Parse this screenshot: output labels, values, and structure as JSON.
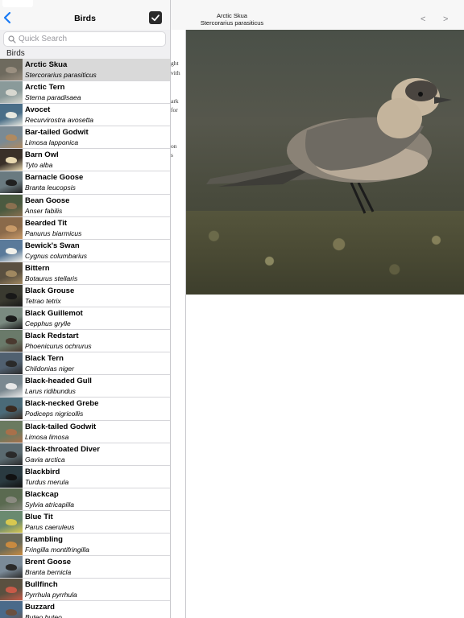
{
  "master": {
    "title": "Birds",
    "back_icon": "chevron-left-icon",
    "done_icon": "checkmark-icon",
    "search": {
      "placeholder": "Quick Search",
      "value": ""
    },
    "section_header": "Birds",
    "items": [
      {
        "name": "Arctic Skua",
        "latin": "Stercorarius parasiticus",
        "selected": true,
        "colors": [
          "#6e6a5e",
          "#9a8f80"
        ]
      },
      {
        "name": "Arctic Tern",
        "latin": "Sterna paradisaea",
        "colors": [
          "#8a9a9a",
          "#d8d8d0"
        ]
      },
      {
        "name": "Avocet",
        "latin": "Recurvirostra avosetta",
        "colors": [
          "#4a6e88",
          "#e8e8e0"
        ]
      },
      {
        "name": "Bar-tailed Godwit",
        "latin": "Limosa lapponica",
        "colors": [
          "#7a8a94",
          "#b08a60"
        ]
      },
      {
        "name": "Barn Owl",
        "latin": "Tyto alba",
        "colors": [
          "#3a3028",
          "#e8d8b0"
        ]
      },
      {
        "name": "Barnacle Goose",
        "latin": "Branta leucopsis",
        "colors": [
          "#6a7a80",
          "#202020"
        ]
      },
      {
        "name": "Bean Goose",
        "latin": "Anser fabilis",
        "colors": [
          "#4a5a40",
          "#8a7050"
        ]
      },
      {
        "name": "Bearded Tit",
        "latin": "Panurus biarmicus",
        "colors": [
          "#8a6a4a",
          "#c89a68"
        ]
      },
      {
        "name": "Bewick's Swan",
        "latin": "Cygnus columbarius",
        "colors": [
          "#5a7a9a",
          "#f0f0ea"
        ]
      },
      {
        "name": "Bittern",
        "latin": "Botaurus stellaris",
        "colors": [
          "#5a5040",
          "#a08860"
        ]
      },
      {
        "name": "Black Grouse",
        "latin": "Tetrao tetrix",
        "colors": [
          "#3a3a30",
          "#181818"
        ]
      },
      {
        "name": "Black Guillemot",
        "latin": "Cepphus grylle",
        "colors": [
          "#7a8a80",
          "#1a1a1a"
        ]
      },
      {
        "name": "Black Redstart",
        "latin": "Phoenicurus ochrurus",
        "colors": [
          "#6a7a6a",
          "#4a3a30"
        ]
      },
      {
        "name": "Black Tern",
        "latin": "Chlidonias niger",
        "colors": [
          "#506070",
          "#2a2a2a"
        ]
      },
      {
        "name": "Black-headed Gull",
        "latin": "Larus ridibundus",
        "colors": [
          "#7a8890",
          "#e8e8e8"
        ]
      },
      {
        "name": "Black-necked Grebe",
        "latin": "Podiceps nigricollis",
        "colors": [
          "#4a6a78",
          "#3a2a20"
        ]
      },
      {
        "name": "Black-tailed Godwit",
        "latin": "Limosa limosa",
        "colors": [
          "#6a7a60",
          "#a8704a"
        ]
      },
      {
        "name": "Black-throated Diver",
        "latin": "Gavia arctica",
        "colors": [
          "#5a6a70",
          "#2a2a2a"
        ]
      },
      {
        "name": "Blackbird",
        "latin": "Turdus merula",
        "colors": [
          "#2a3a40",
          "#111111"
        ]
      },
      {
        "name": "Blackcap",
        "latin": "Sylvia atricapilla",
        "colors": [
          "#5a6a50",
          "#8a8a80"
        ]
      },
      {
        "name": "Blue Tit",
        "latin": "Parus caeruleus",
        "colors": [
          "#6a8a70",
          "#d8c850"
        ]
      },
      {
        "name": "Brambling",
        "latin": "Fringilla montifringilla",
        "colors": [
          "#6a6a58",
          "#c88a40"
        ]
      },
      {
        "name": "Brent Goose",
        "latin": "Branta bernicla",
        "colors": [
          "#7a8a98",
          "#2a2a2a"
        ]
      },
      {
        "name": "Bullfinch",
        "latin": "Pyrrhula pyrrhula",
        "colors": [
          "#5a5040",
          "#c85a48"
        ]
      },
      {
        "name": "Buzzard",
        "latin": "Buteo buteo",
        "colors": [
          "#4a6a8a",
          "#6a5040"
        ]
      }
    ]
  },
  "detail": {
    "title": "Arctic Skua",
    "subtitle": "Stercorarius parasiticus",
    "prev_label": "<",
    "next_label": ">",
    "peek_lines": [
      "ght",
      "vith",
      "ark",
      "for",
      "on",
      "s"
    ]
  }
}
